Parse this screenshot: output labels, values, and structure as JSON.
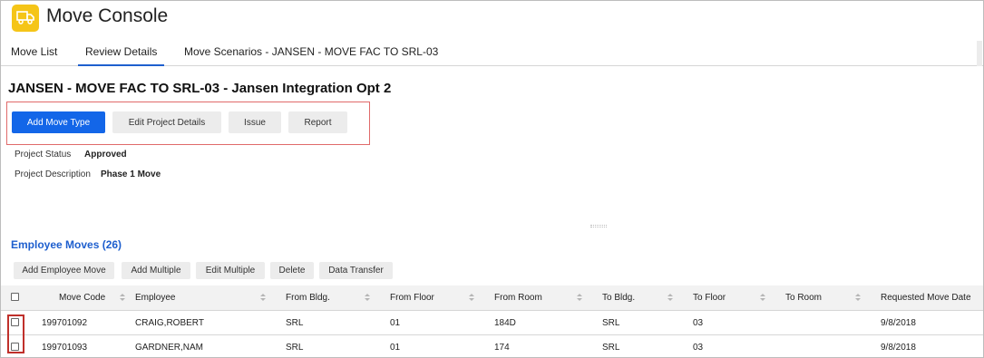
{
  "header": {
    "title": "Move Console",
    "logo_icon": "truck-icon",
    "logo_color": "#f5c518"
  },
  "tabs": [
    {
      "label": "Move List"
    },
    {
      "label": "Review Details",
      "active": true
    },
    {
      "label": "Move Scenarios - JANSEN - MOVE FAC TO SRL-03"
    }
  ],
  "project": {
    "title": "JANSEN - MOVE FAC TO SRL-03 - Jansen Integration Opt 2",
    "status_label": "Project Status",
    "status_value": "Approved",
    "description_label": "Project Description",
    "description_value": "Phase 1 Move"
  },
  "actions": {
    "add_move_type": "Add Move Type",
    "edit_project_details": "Edit Project Details",
    "issue": "Issue",
    "report": "Report"
  },
  "employee_moves": {
    "title": "Employee Moves (26)",
    "buttons": {
      "add_employee_move": "Add Employee Move",
      "add_multiple": "Add Multiple",
      "edit_multiple": "Edit Multiple",
      "delete": "Delete",
      "data_transfer": "Data Transfer"
    },
    "columns": [
      "Move Code",
      "Employee",
      "From Bldg.",
      "From Floor",
      "From Room",
      "To Bldg.",
      "To Floor",
      "To Room",
      "Requested Move Date"
    ],
    "rows": [
      {
        "move_code": "199701092",
        "employee": "CRAIG,ROBERT",
        "from_bldg": "SRL",
        "from_floor": "01",
        "from_room": "184D",
        "to_bldg": "SRL",
        "to_floor": "03",
        "to_room": "",
        "requested_date": "9/8/2018"
      },
      {
        "move_code": "199701093",
        "employee": "GARDNER,NAM",
        "from_bldg": "SRL",
        "from_floor": "01",
        "from_room": "174",
        "to_bldg": "SRL",
        "to_floor": "03",
        "to_room": "",
        "requested_date": "9/8/2018"
      }
    ]
  },
  "colors": {
    "accent": "#1366e8",
    "link": "#1e5fce",
    "highlight_border": "#e06a6a",
    "checkbox_highlight": "#c0302b"
  }
}
